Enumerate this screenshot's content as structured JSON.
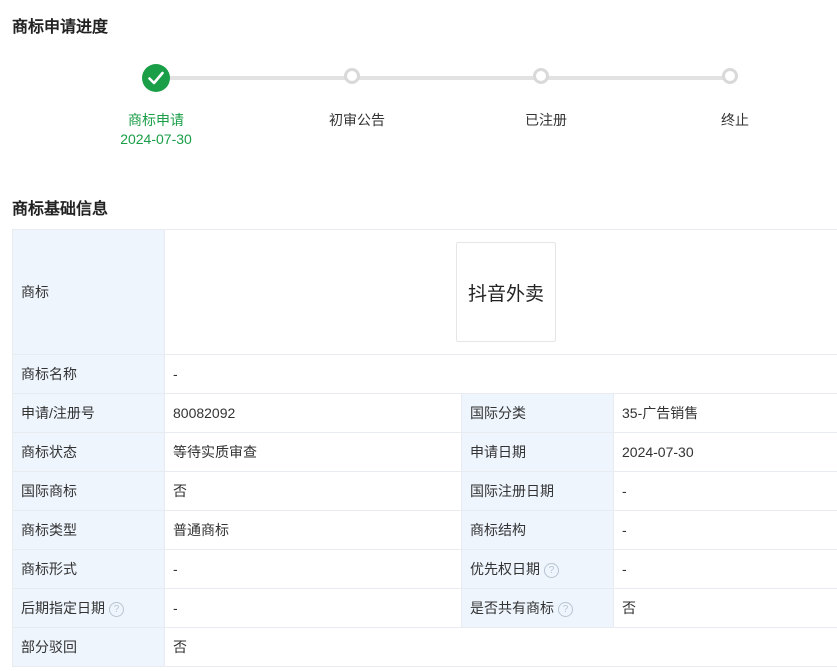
{
  "progress": {
    "title": "商标申请进度",
    "steps": [
      {
        "label": "商标申请",
        "date": "2024-07-30",
        "status": "done"
      },
      {
        "label": "初审公告",
        "date": "",
        "status": "pending"
      },
      {
        "label": "已注册",
        "date": "",
        "status": "pending"
      },
      {
        "label": "终止",
        "date": "",
        "status": "pending"
      }
    ]
  },
  "basic": {
    "title": "商标基础信息",
    "logo_label": "商标",
    "logo_text": "抖音外卖",
    "name_label": "商标名称",
    "name_value": "-",
    "rows": [
      {
        "l1": "申请/注册号",
        "v1": "80082092",
        "l2": "国际分类",
        "v2": "35-广告销售"
      },
      {
        "l1": "商标状态",
        "v1": "等待实质审查",
        "l2": "申请日期",
        "v2": "2024-07-30"
      },
      {
        "l1": "国际商标",
        "v1": "否",
        "l2": "国际注册日期",
        "v2": "-"
      },
      {
        "l1": "商标类型",
        "v1": "普通商标",
        "l2": "商标结构",
        "v2": "-"
      },
      {
        "l1": "商标形式",
        "v1": "-",
        "l2": "优先权日期",
        "v2": "-"
      },
      {
        "l1": "后期指定日期",
        "v1": "-",
        "l2": "是否共有商标",
        "v2": "否"
      }
    ],
    "partial_label": "部分驳回",
    "partial_value": "否"
  },
  "help_glyph": "?",
  "colors": {
    "accent": "#1a9e47",
    "label_bg": "#eef5fd",
    "border": "#e8ecf0"
  }
}
